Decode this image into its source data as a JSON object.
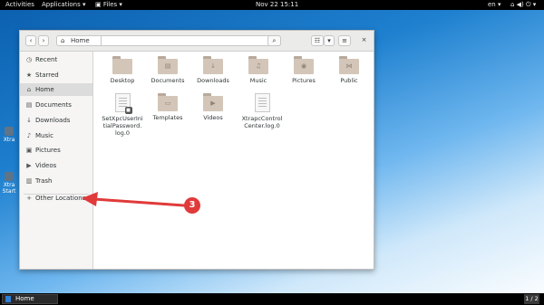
{
  "topbar": {
    "activities": "Activities",
    "applications": "Applications ▾",
    "files": "Files ▾",
    "clock": "Nov 22  15:11",
    "language": "en ▾",
    "system_icons": "⌂ ◀) ⏻ ▾"
  },
  "desktop_icons": [
    {
      "label": "Xtra"
    },
    {
      "label": "Xtra Start"
    }
  ],
  "window": {
    "path": {
      "home_label": "Home"
    },
    "buttons": {
      "back": "‹",
      "forward": "›",
      "search": "⌕",
      "view": "☷",
      "view_dropdown": "▾",
      "menu": "≡",
      "close": "×"
    }
  },
  "sidebar": {
    "items": [
      {
        "icon": "clock-icon",
        "glyph": "◷",
        "label": "Recent"
      },
      {
        "icon": "star-icon",
        "glyph": "★",
        "label": "Starred"
      },
      {
        "icon": "home-icon",
        "glyph": "⌂",
        "label": "Home"
      },
      {
        "icon": "documents-icon",
        "glyph": "▤",
        "label": "Documents"
      },
      {
        "icon": "download-icon",
        "glyph": "↓",
        "label": "Downloads"
      },
      {
        "icon": "music-icon",
        "glyph": "♪",
        "label": "Music"
      },
      {
        "icon": "pictures-icon",
        "glyph": "▣",
        "label": "Pictures"
      },
      {
        "icon": "videos-icon",
        "glyph": "▶",
        "label": "Videos"
      },
      {
        "icon": "trash-icon",
        "glyph": "▥",
        "label": "Trash"
      },
      {
        "icon": "plus-icon",
        "glyph": "+",
        "label": "Other Locations"
      }
    ]
  },
  "files": [
    {
      "label": "Desktop",
      "emblem": ""
    },
    {
      "label": "Documents",
      "emblem": "▤"
    },
    {
      "label": "Downloads",
      "emblem": "↓"
    },
    {
      "label": "Music",
      "emblem": "♫"
    },
    {
      "label": "Pictures",
      "emblem": "◉"
    },
    {
      "label": "Public",
      "emblem": "⋈"
    },
    {
      "label": "SetXpcUserInitialPassword.log.0",
      "line1": "SetXpcUserIni",
      "line2": "tialPassword.",
      "line3": "log.0"
    },
    {
      "label": "Templates",
      "emblem": "▭"
    },
    {
      "label": "Videos",
      "emblem": "▶"
    },
    {
      "label": "XtrapcControlCenter.log.0",
      "line1": "XtrapcControl",
      "line2": "Center.log.0"
    }
  ],
  "annotation": {
    "number": "3",
    "color": "#e03a3a"
  },
  "taskbar": {
    "task_label": "Home",
    "workspace": "1 / 2"
  }
}
